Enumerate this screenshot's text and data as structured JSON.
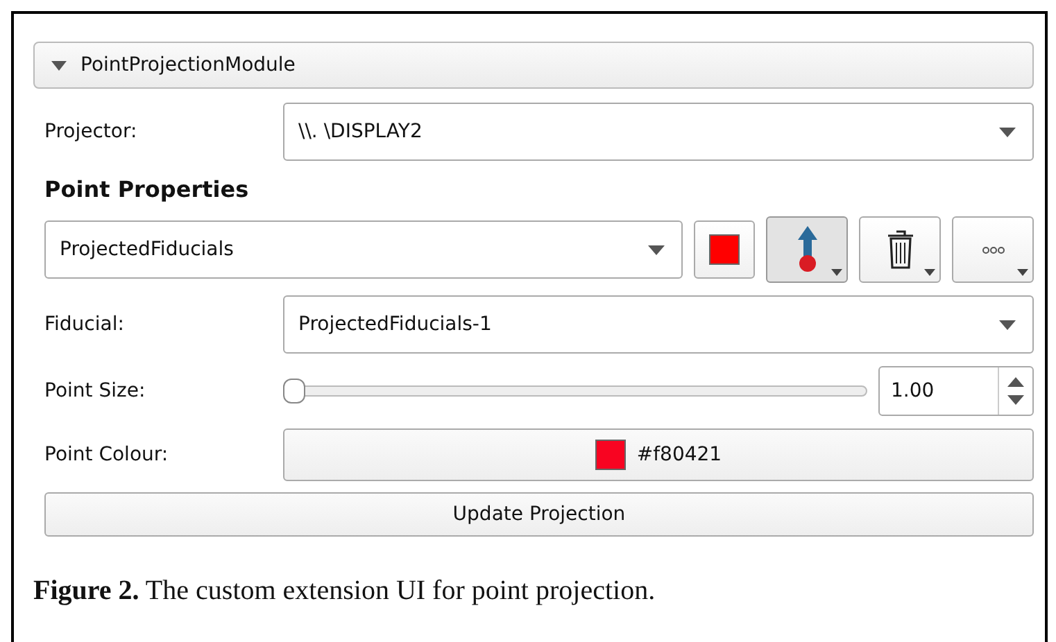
{
  "module": {
    "title": "PointProjectionModule",
    "expanded": true
  },
  "projector": {
    "label": "Projector:",
    "value": "\\\\. \\DISPLAY2"
  },
  "section_title": "Point Properties",
  "node_selector": {
    "value": "ProjectedFiducials",
    "color": "#ff0000",
    "place_selected": true
  },
  "fiducial": {
    "label": "Fiducial:",
    "value": "ProjectedFiducials-1"
  },
  "point_size": {
    "label": "Point Size:",
    "level": 0,
    "value": "1.00"
  },
  "point_colour": {
    "label": "Point Colour:",
    "color": "#f80421",
    "value": "#f80421"
  },
  "update_button": "Update Projection",
  "caption": "**Figure 2.** The custom extension UI for point projection."
}
